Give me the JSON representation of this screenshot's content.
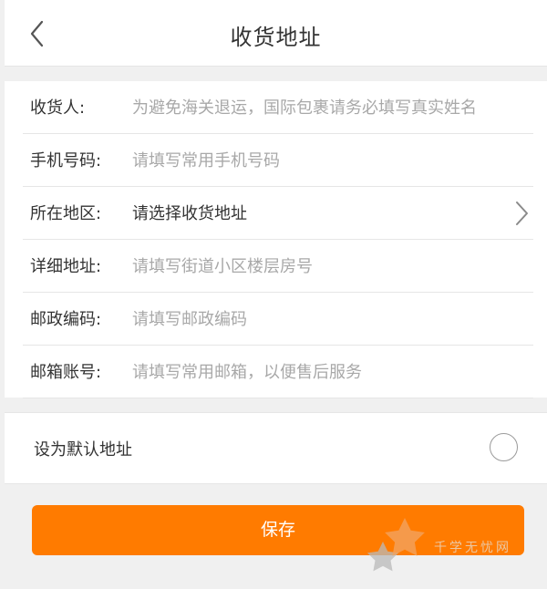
{
  "header": {
    "title": "收货地址",
    "back_icon": "chevron-left-icon"
  },
  "form": {
    "rows": [
      {
        "label": "收货人:",
        "placeholder": "为避免海关退运，国际包裹请务必填写真实姓名"
      },
      {
        "label": "手机号码:",
        "placeholder": "请填写常用手机号码"
      },
      {
        "label": "所在地区:",
        "value": "请选择收货地址",
        "icon": "chevron-right-icon"
      },
      {
        "label": "详细地址:",
        "placeholder": "请填写街道小区楼层房号"
      },
      {
        "label": "邮政编码:",
        "placeholder": "请填写邮政编码"
      },
      {
        "label": "邮箱账号:",
        "placeholder": "请填写常用邮箱，以便售后服务"
      }
    ]
  },
  "default_address": {
    "label": "设为默认地址",
    "checked": false
  },
  "save": {
    "label": "保存"
  },
  "watermark": {
    "text": "千学无忧网"
  },
  "colors": {
    "accent": "#ff7b00",
    "background": "#f0f0f0",
    "placeholder": "#a8a8a8",
    "text": "#333333"
  }
}
